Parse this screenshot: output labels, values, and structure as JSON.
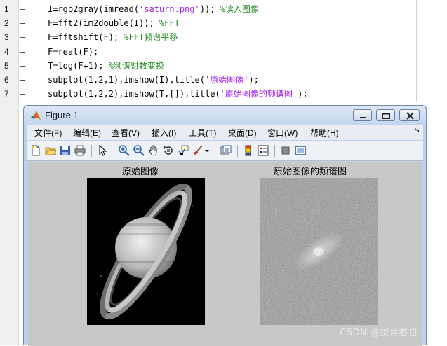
{
  "editor": {
    "lines": [
      {
        "num": "1",
        "code": "I=rgb2gray(imread(",
        "str": "'saturn.png'",
        "rest": ")); ",
        "comment": "%读入图像"
      },
      {
        "num": "2",
        "code": "F=fft2(im2double(I)); ",
        "str": "",
        "rest": "",
        "comment": "%FFT"
      },
      {
        "num": "3",
        "code": "F=fftshift(F); ",
        "str": "",
        "rest": "",
        "comment": "%FFT频谱平移"
      },
      {
        "num": "4",
        "code": "F=real(F);",
        "str": "",
        "rest": "",
        "comment": ""
      },
      {
        "num": "5",
        "code": "T=log(F+1); ",
        "str": "",
        "rest": "",
        "comment": "%频谱对数变换"
      },
      {
        "num": "6",
        "code": "subplot(1,2,1),imshow(I),title(",
        "str": "'原始图像'",
        "rest": ");",
        "comment": ""
      },
      {
        "num": "7",
        "code": "subplot(1,2,2),imshow(T,[]),title(",
        "str": "'原始图像的频谱图'",
        "rest": ");",
        "comment": ""
      }
    ],
    "dash": "–"
  },
  "figure": {
    "title": "Figure 1",
    "menus": [
      "文件(F)",
      "编辑(E)",
      "查看(V)",
      "插入(I)",
      "工具(T)",
      "桌面(D)",
      "窗口(W)",
      "帮助(H)"
    ],
    "toolbar_icons": [
      "new-file-icon",
      "open-folder-icon",
      "save-icon",
      "print-icon",
      "pointer-icon",
      "zoom-in-icon",
      "zoom-out-icon",
      "pan-hand-icon",
      "rotate-3d-icon",
      "data-cursor-icon",
      "brush-icon",
      "link-plot-icon",
      "colorbar-icon",
      "legend-icon",
      "hide-plot-tools-icon",
      "show-plot-tools-icon"
    ],
    "axes": [
      {
        "title": "原始图像"
      },
      {
        "title": "原始图像的频谱图"
      }
    ]
  },
  "watermark": "CSDN @拔丝憨包",
  "colors": {
    "comment": "#228b22",
    "string": "#a020f0",
    "canvas": "#c8c8c8",
    "titlebar": "#c2d6ee"
  }
}
